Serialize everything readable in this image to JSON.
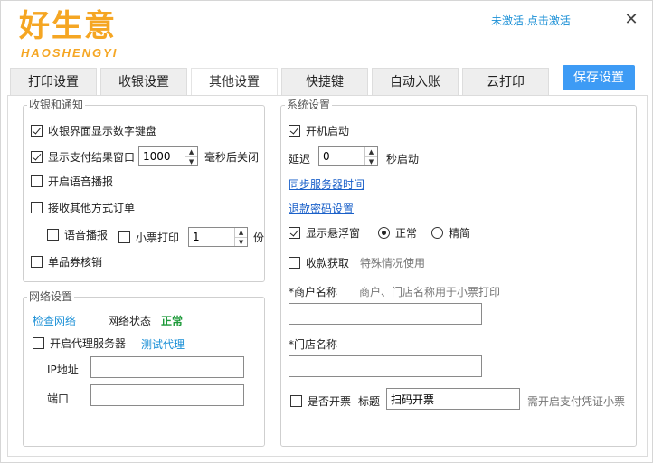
{
  "header": {
    "logo_cn": "好生意",
    "logo_en": "HAOSHENGYI",
    "activate_link": "未激活,点击激活",
    "close_symbol": "✕"
  },
  "tabs": [
    {
      "label": "打印设置",
      "active": false
    },
    {
      "label": "收银设置",
      "active": false
    },
    {
      "label": "其他设置",
      "active": true
    },
    {
      "label": "快捷键",
      "active": false
    },
    {
      "label": "自动入账",
      "active": false
    },
    {
      "label": "云打印",
      "active": false
    }
  ],
  "save_button": "保存设置",
  "cashier_group": {
    "title": "收银和通知",
    "show_keypad": {
      "label": "收银界面显示数字键盘",
      "checked": true
    },
    "show_result": {
      "label": "显示支付结果窗口",
      "checked": true,
      "value": "1000",
      "suffix": "毫秒后关闭"
    },
    "voice": {
      "label": "开启语音播报",
      "checked": false
    },
    "other_orders": {
      "label": "接收其他方式订单",
      "checked": false
    },
    "voice_sub": {
      "label": "语音播报",
      "checked": false
    },
    "receipt_print": {
      "label": "小票打印",
      "checked": false,
      "value": "1",
      "suffix": "份"
    },
    "coupon": {
      "label": "单品券核销",
      "checked": false
    }
  },
  "network_group": {
    "title": "网络设置",
    "check_link": "检查网络",
    "status_label": "网络状态",
    "status_value": "正常",
    "proxy": {
      "label": "开启代理服务器",
      "checked": false
    },
    "test_proxy": "测试代理",
    "ip_label": "IP地址",
    "ip_value": "",
    "port_label": "端口",
    "port_value": ""
  },
  "system_group": {
    "title": "系统设置",
    "autostart": {
      "label": "开机启动",
      "checked": true
    },
    "delay_label": "延迟",
    "delay_value": "0",
    "delay_suffix": "秒启动",
    "sync_time_link": "同步服务器时间",
    "refund_pwd_link": "退款密码设置",
    "float_window": {
      "label": "显示悬浮窗",
      "checked": true
    },
    "mode_normal": {
      "label": "正常",
      "checked": true
    },
    "mode_simple": {
      "label": "精简",
      "checked": false
    },
    "collect": {
      "label": "收款获取",
      "checked": false,
      "hint": "特殊情况使用"
    },
    "merchant_label": "*商户名称",
    "merchant_hint": "商户、门店名称用于小票打印",
    "merchant_value": "",
    "store_label": "*门店名称",
    "store_value": "",
    "invoice": {
      "label": "是否开票",
      "checked": false
    },
    "invoice_title_label": "标题",
    "invoice_title_value": "扫码开票",
    "invoice_hint": "需开启支付凭证小票"
  }
}
